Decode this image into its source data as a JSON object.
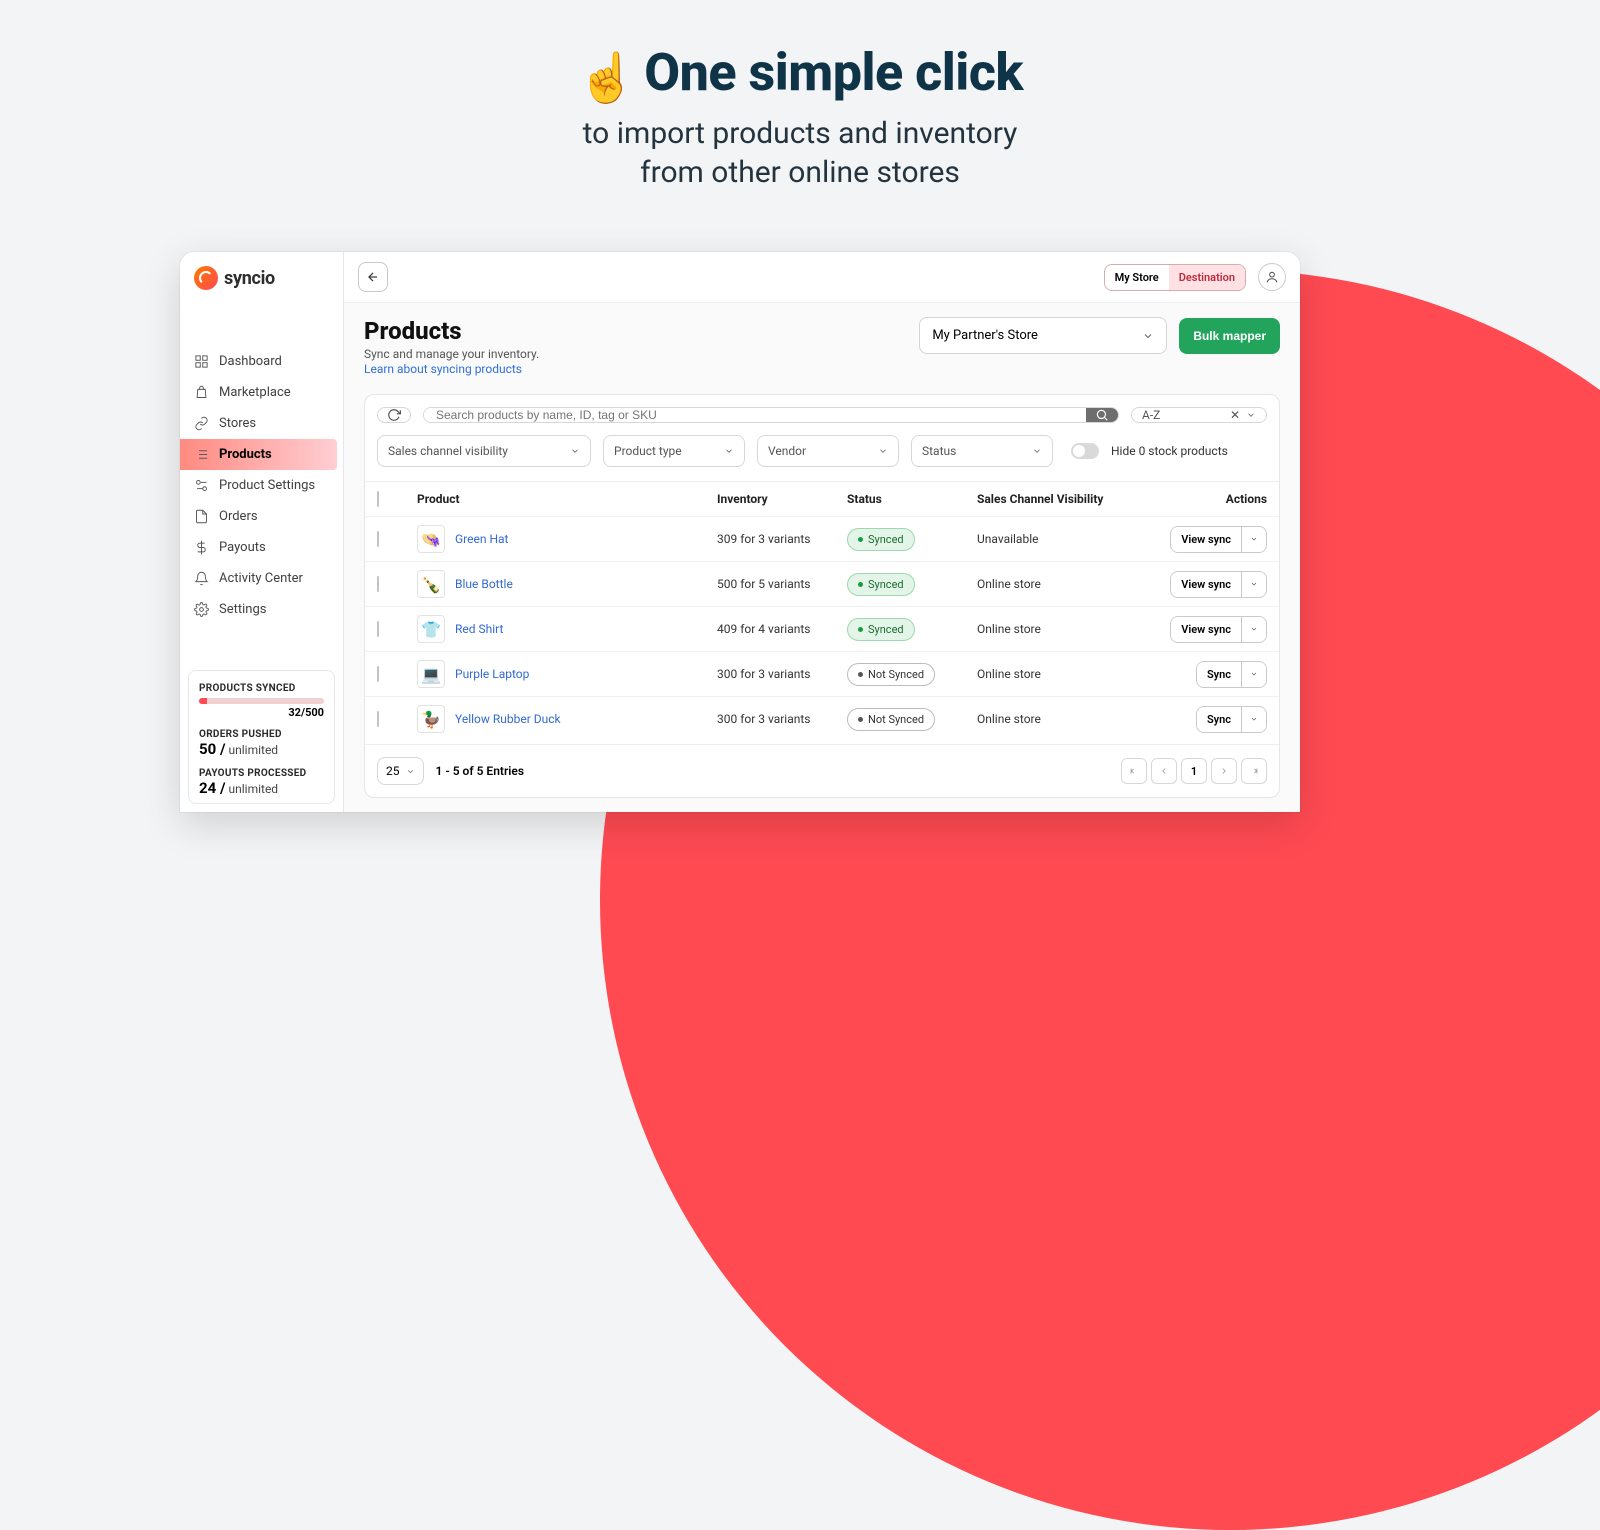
{
  "hero": {
    "emoji": "☝️",
    "title": "One simple click",
    "subtitle_l1": "to import products and inventory",
    "subtitle_l2": "from other online stores"
  },
  "logo_text": "syncio",
  "nav": {
    "dashboard": "Dashboard",
    "marketplace": "Marketplace",
    "stores": "Stores",
    "products": "Products",
    "product_settings": "Product Settings",
    "orders": "Orders",
    "payouts": "Payouts",
    "activity": "Activity Center",
    "settings": "Settings"
  },
  "stats": {
    "synced_label": "PRODUCTS SYNCED",
    "synced_count": "32/500",
    "orders_label": "ORDERS PUSHED",
    "orders_value": "50 /",
    "orders_unit": " unlimited",
    "payouts_label": "PAYOUTS PROCESSED",
    "payouts_value": "24 /",
    "payouts_unit": " unlimited"
  },
  "topbar": {
    "my_store": "My Store",
    "destination": "Destination"
  },
  "page": {
    "title": "Products",
    "subtitle": "Sync and manage your inventory.",
    "learn_link": "Learn about syncing products",
    "store_select": "My Partner's Store",
    "bulk_btn": "Bulk mapper"
  },
  "filters": {
    "search_placeholder": "Search products by name, ID, tag or SKU",
    "sort": "A-Z",
    "channel": "Sales channel visibility",
    "ptype": "Product type",
    "vendor": "Vendor",
    "status": "Status",
    "hide0": "Hide 0 stock products"
  },
  "table": {
    "h_product": "Product",
    "h_inventory": "Inventory",
    "h_status": "Status",
    "h_visibility": "Sales Channel Visibility",
    "h_actions": "Actions",
    "rows": [
      {
        "emoji": "👒",
        "name": "Green Hat",
        "inventory": "309 for 3 variants",
        "status": "Synced",
        "visibility": "Unavailable",
        "action": "View sync"
      },
      {
        "emoji": "🍾",
        "name": "Blue Bottle",
        "inventory": "500 for 5 variants",
        "status": "Synced",
        "visibility": "Online store",
        "action": "View sync"
      },
      {
        "emoji": "👕",
        "name": "Red Shirt",
        "inventory": "409 for 4 variants",
        "status": "Synced",
        "visibility": "Online store",
        "action": "View sync"
      },
      {
        "emoji": "💻",
        "name": "Purple Laptop",
        "inventory": "300 for 3 variants",
        "status": "Not Synced",
        "visibility": "Online store",
        "action": "Sync"
      },
      {
        "emoji": "🦆",
        "name": "Yellow Rubber Duck",
        "inventory": "300 for 3 variants",
        "status": "Not Synced",
        "visibility": "Online store",
        "action": "Sync"
      }
    ]
  },
  "footer": {
    "perpage": "25",
    "entries": "1 - 5 of 5 Entries",
    "page": "1"
  }
}
